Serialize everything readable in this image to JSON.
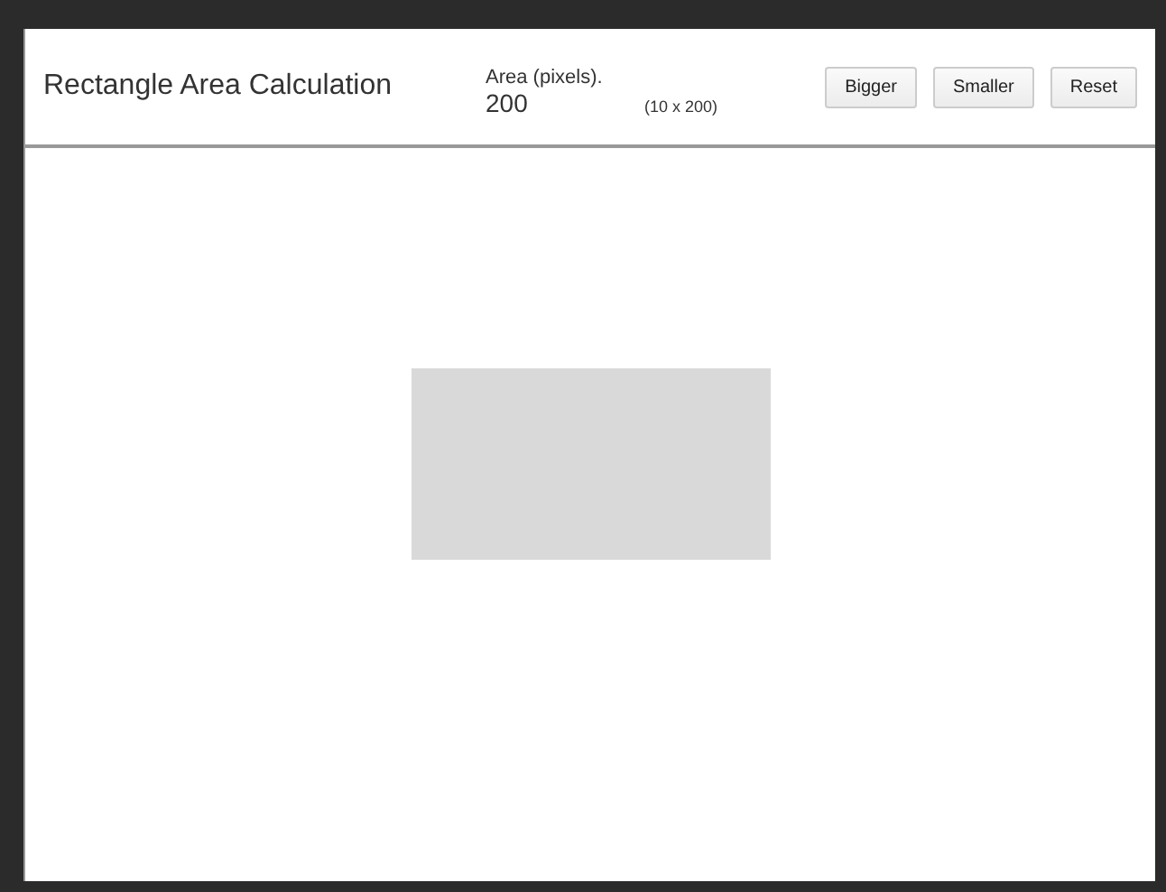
{
  "header": {
    "title": "Rectangle Area Calculation",
    "area_label": "Area (pixels).",
    "area_value": "200",
    "dimensions": "(10 x 200)"
  },
  "buttons": [
    "Bigger",
    "Smaller",
    "Reset"
  ]
}
